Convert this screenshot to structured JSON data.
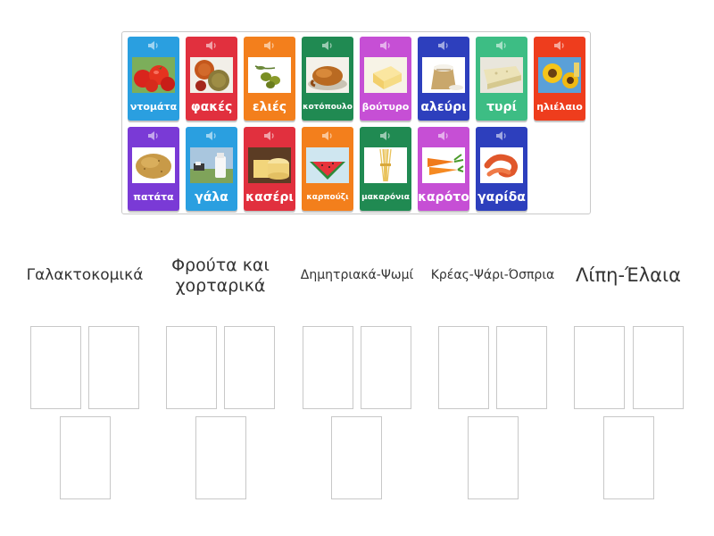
{
  "colors": {
    "blue": "#2a9fe0",
    "red": "#e1303e",
    "orange": "#f37f1c",
    "green": "#208a52",
    "magenta": "#c64fd5",
    "navy": "#2d3fbd",
    "mint": "#3dbd84",
    "scarlet": "#ee3d1d",
    "purple": "#7a3ad6"
  },
  "cards": [
    {
      "label": "ντομάτα",
      "color": "#2a9fe0",
      "icon": "tomato-icon"
    },
    {
      "label": "φακές",
      "color": "#e1303e",
      "icon": "lentils-icon"
    },
    {
      "label": "ελιές",
      "color": "#f37f1c",
      "icon": "olives-icon"
    },
    {
      "label": "κοτόπουλο",
      "color": "#208a52",
      "icon": "roast-chicken-icon"
    },
    {
      "label": "βούτυρο",
      "color": "#c64fd5",
      "icon": "butter-icon"
    },
    {
      "label": "αλεύρι",
      "color": "#2d3fbd",
      "icon": "flour-icon"
    },
    {
      "label": "τυρί",
      "color": "#3dbd84",
      "icon": "cheese-slice-icon"
    },
    {
      "label": "ηλιέλαιο",
      "color": "#ee3d1d",
      "icon": "sunflower-icon"
    },
    {
      "label": "πατάτα",
      "color": "#7a3ad6",
      "icon": "potato-icon"
    },
    {
      "label": "γάλα",
      "color": "#2a9fe0",
      "icon": "milk-icon"
    },
    {
      "label": "κασέρι",
      "color": "#e1303e",
      "icon": "kasseri-cheese-icon"
    },
    {
      "label": "καρπούζι",
      "color": "#f37f1c",
      "icon": "watermelon-icon"
    },
    {
      "label": "μακαρόνια",
      "color": "#208a52",
      "icon": "spaghetti-icon"
    },
    {
      "label": "καρότο",
      "color": "#c64fd5",
      "icon": "carrot-icon"
    },
    {
      "label": "γαρίδα",
      "color": "#2d3fbd",
      "icon": "shrimp-icon"
    }
  ],
  "categories": [
    {
      "title": "Γαλακτοκομικά"
    },
    {
      "title": "Φρούτα και χορταρικά"
    },
    {
      "title": "Δημητριακά-Ψωμί"
    },
    {
      "title": "Κρέας-Ψάρι-Όσπρια"
    },
    {
      "title": "Λίπη-Έλαια"
    }
  ]
}
